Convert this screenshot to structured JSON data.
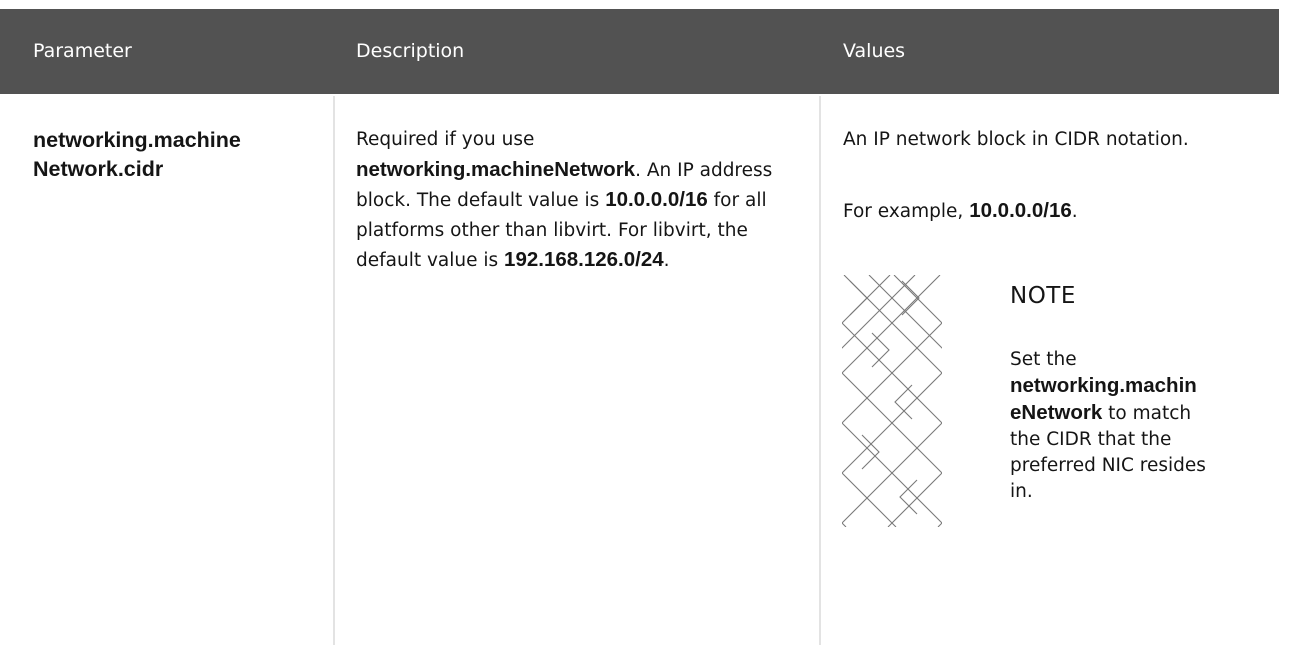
{
  "table": {
    "headers": [
      "Parameter",
      "Description",
      "Values"
    ],
    "row": {
      "parameter_line1": "networking.machine",
      "parameter_line2": "Network.cidr",
      "description": {
        "t1": "Required if you use ",
        "b1": "networking.machineNetwork",
        "t2": ". An IP address block. The default value is ",
        "b2": "10.0.0.0/16",
        "t3": " for all platforms other than libvirt. For libvirt, the default value is ",
        "b3": "192.168.126.0/24",
        "t4": "."
      },
      "values": {
        "line1": "An IP network block in CIDR notation.",
        "example_prefix": "For example, ",
        "example_value": "10.0.0.0/16",
        "example_suffix": "."
      },
      "note": {
        "title": "NOTE",
        "t1": "Set the ",
        "b1_line1": "networking.machin",
        "b1_line2": "eNetwork",
        "t2": " to match the CIDR that the preferred NIC resides in."
      }
    }
  },
  "colors": {
    "header_bg": "#525252",
    "header_text": "#ffffff",
    "divider": "#e3e3e3",
    "body_text": "#151515",
    "note_art": "#7a7a7a"
  },
  "icons": {
    "note_art": "crosshatch-pattern"
  }
}
